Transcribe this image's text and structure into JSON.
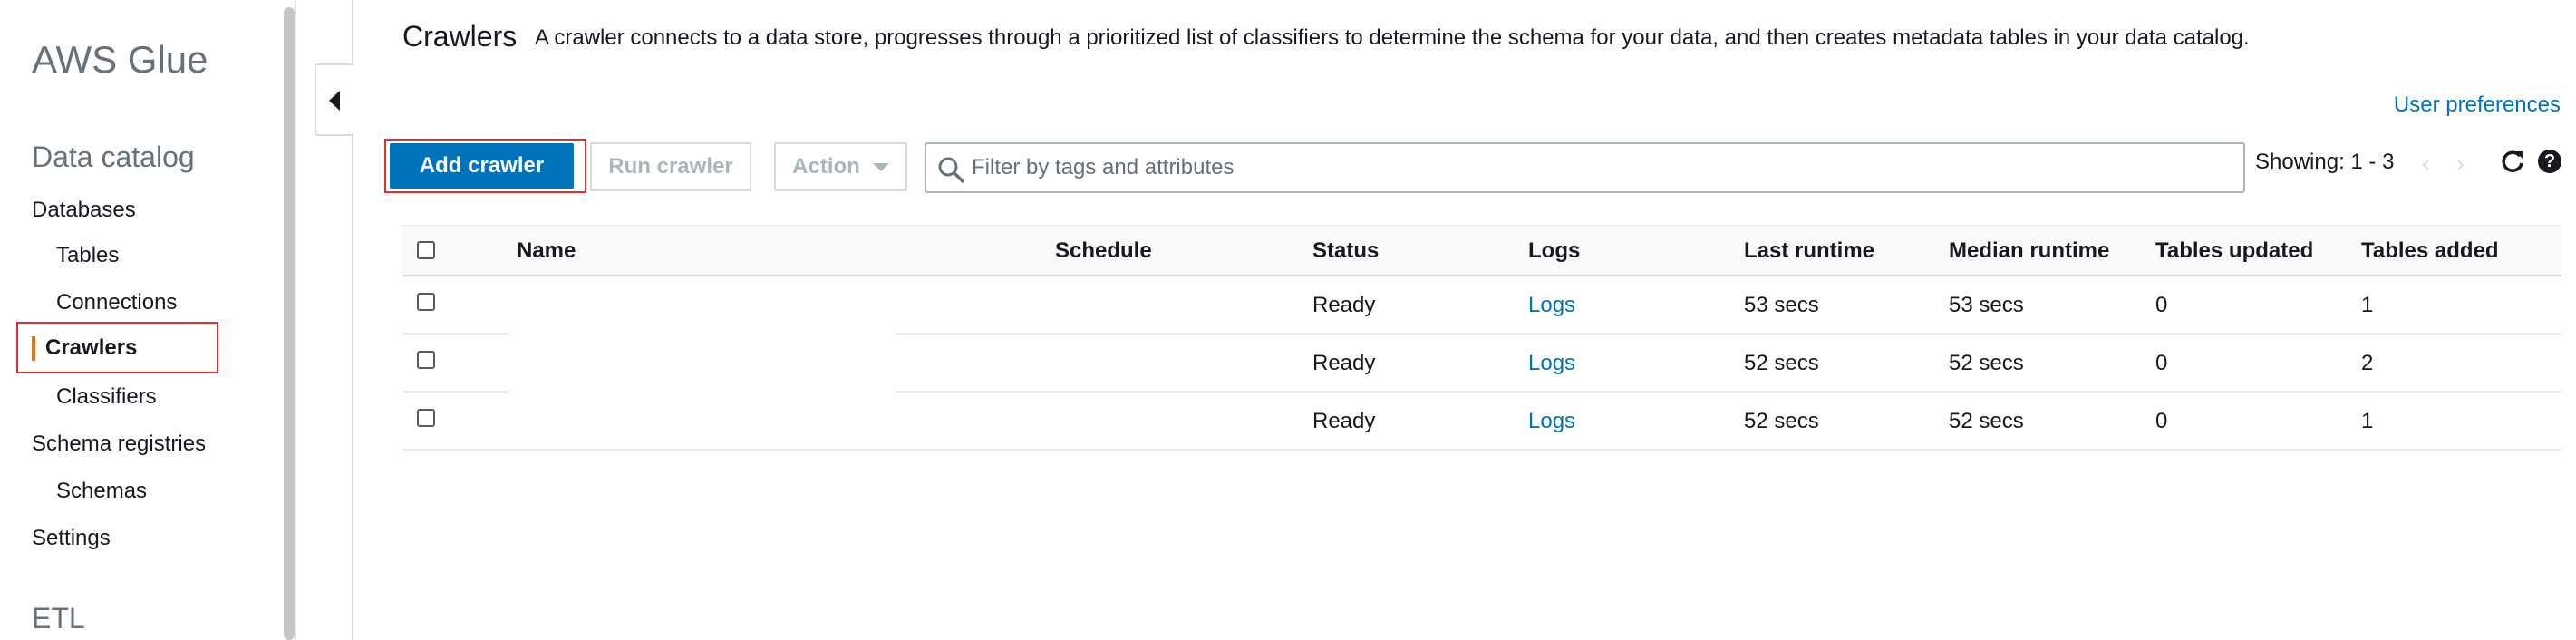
{
  "sidebar": {
    "brand": "AWS Glue",
    "section_data_catalog": "Data catalog",
    "items": {
      "databases": "Databases",
      "tables": "Tables",
      "connections": "Connections",
      "crawlers": "Crawlers",
      "classifiers": "Classifiers",
      "schema_registries": "Schema registries",
      "schemas": "Schemas",
      "settings": "Settings"
    },
    "section_etl": "ETL",
    "active_item": "Crawlers"
  },
  "header": {
    "title": "Crawlers",
    "description": "A crawler connects to a data store, progresses through a prioritized list of classifiers to determine the schema for your data, and then creates metadata tables in your data catalog.",
    "user_preferences": "User preferences"
  },
  "toolbar": {
    "add_crawler": "Add crawler",
    "run_crawler": "Run crawler",
    "action": "Action",
    "filter_placeholder": "Filter by tags and attributes",
    "showing": "Showing: 1 - 3",
    "prev": "‹",
    "next": "›"
  },
  "table": {
    "columns": [
      "Name",
      "Schedule",
      "Status",
      "Logs",
      "Last runtime",
      "Median runtime",
      "Tables updated",
      "Tables added"
    ],
    "rows": [
      {
        "name": "",
        "schedule": "",
        "status": "Ready",
        "logs": "Logs",
        "last_runtime": "53 secs",
        "median_runtime": "53 secs",
        "tables_updated": "0",
        "tables_added": "1"
      },
      {
        "name": "",
        "schedule": "",
        "status": "Ready",
        "logs": "Logs",
        "last_runtime": "52 secs",
        "median_runtime": "52 secs",
        "tables_updated": "0",
        "tables_added": "2"
      },
      {
        "name": "",
        "schedule": "",
        "status": "Ready",
        "logs": "Logs",
        "last_runtime": "52 secs",
        "median_runtime": "52 secs",
        "tables_updated": "0",
        "tables_added": "1"
      }
    ]
  },
  "colors": {
    "primary": "#0073bb",
    "active_accent": "#ec7211",
    "highlight_box": "#e02f2f",
    "muted_text": "#687078"
  },
  "icons": [
    "caret-left-icon",
    "search-icon",
    "chevron-left-icon",
    "chevron-right-icon",
    "refresh-icon",
    "help-icon",
    "caret-down-icon"
  ]
}
